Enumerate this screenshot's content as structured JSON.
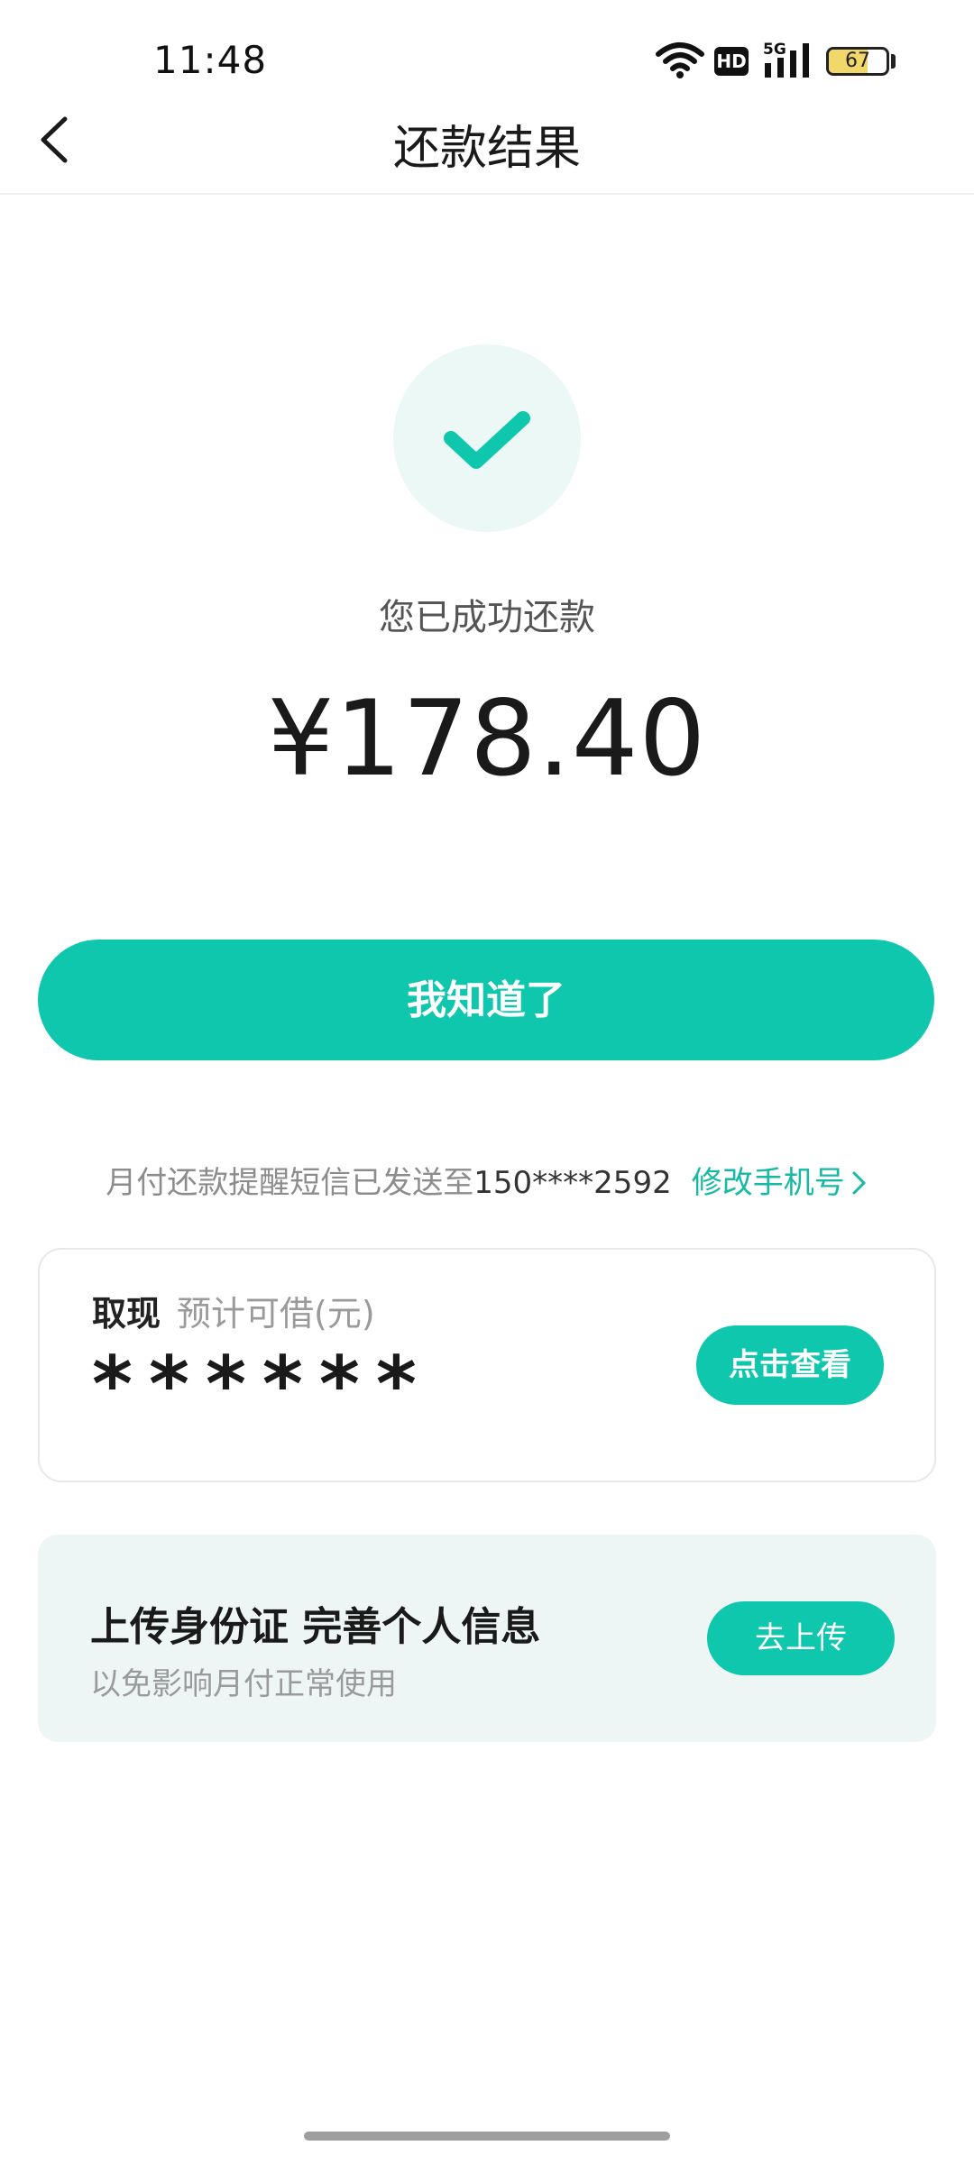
{
  "status_bar": {
    "time": "11:48",
    "hd_label": "HD",
    "network_label": "5G",
    "battery_percent": 67,
    "battery_text": "67"
  },
  "nav": {
    "title": "还款结果",
    "back_icon": "chevron-left-icon"
  },
  "result": {
    "icon": "check-icon",
    "message": "您已成功还款",
    "amount": "¥178.40"
  },
  "primary_button": {
    "label": "我知道了"
  },
  "sms_notice": {
    "text": "月付还款提醒短信已发送至",
    "phone": "150****2592",
    "modify_label": "修改手机号",
    "modify_icon": "chevron-right-icon"
  },
  "cash_card": {
    "title": "取现",
    "subtitle": "预计可借(元)",
    "masked_amount": "******",
    "button_label": "点击查看"
  },
  "upload_card": {
    "title": "上传身份证 完善个人信息",
    "subtitle": "以免影响月付正常使用",
    "button_label": "去上传"
  },
  "colors": {
    "accent": "#0fc7ad",
    "link": "#16b9a3",
    "success_bg": "#ebf8f6",
    "upload_card_bg": "#eef6f5"
  }
}
